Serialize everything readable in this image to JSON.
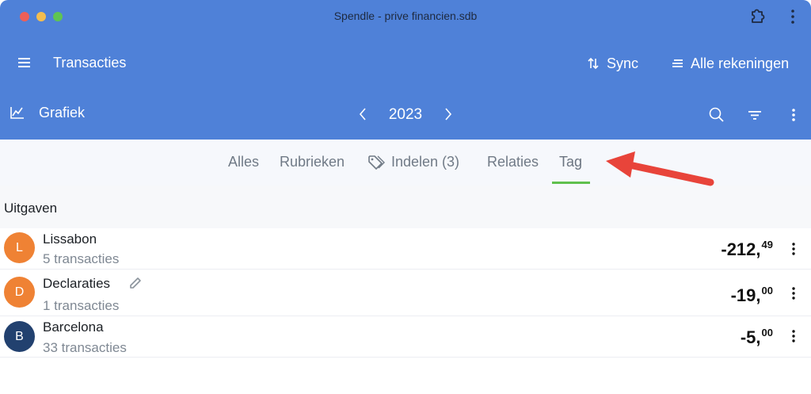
{
  "window": {
    "title": "Spendle - prive financien.sdb"
  },
  "toolbar": {
    "title": "Transacties",
    "sync_label": "Sync",
    "accounts_label": "Alle rekeningen"
  },
  "subbar": {
    "chart_label": "Grafiek",
    "year": "2023"
  },
  "tabs": [
    {
      "label": "Alles",
      "selected": false
    },
    {
      "label": "Rubrieken",
      "selected": false
    },
    {
      "label": "Indelen (3)",
      "selected": false,
      "icon": "tag-icon"
    },
    {
      "label": "Relaties",
      "selected": false
    },
    {
      "label": "Tag",
      "selected": true
    }
  ],
  "section": {
    "title": "Uitgaven"
  },
  "rows": [
    {
      "initial": "L",
      "name": "Lissabon",
      "subtitle": "5 transacties",
      "amount_int": "-212,",
      "amount_dec": "49",
      "avatar_color": "#ef8234"
    },
    {
      "initial": "D",
      "name": "Declaraties",
      "subtitle": "1 transacties",
      "amount_int": "-19,",
      "amount_dec": "00",
      "avatar_color": "#ef8234",
      "edit_icon": "pencil-icon"
    },
    {
      "initial": "B",
      "name": "Barcelona",
      "subtitle": "33 transacties",
      "amount_int": "-5,",
      "amount_dec": "00",
      "avatar_color": "#22416f"
    }
  ],
  "colors": {
    "header_bg": "#4f81d8",
    "tab_indicator": "#60c04d",
    "annotation_arrow": "#e8443a"
  }
}
